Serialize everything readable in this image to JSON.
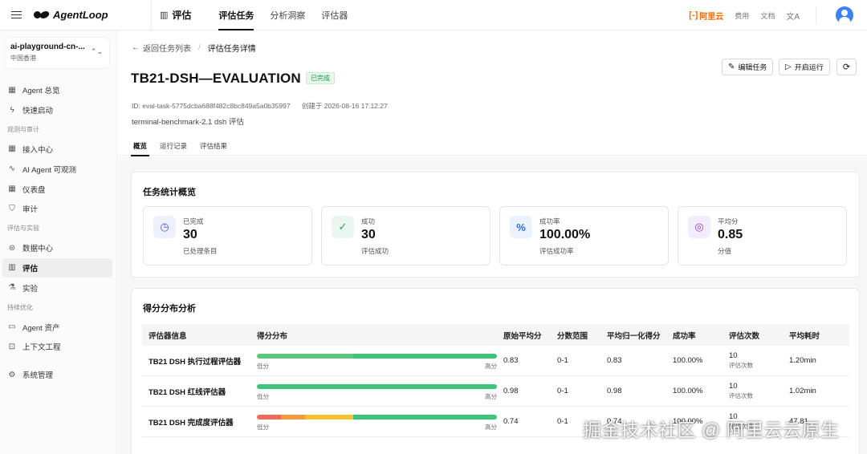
{
  "top": {
    "logo": "AgentLoop",
    "section": "评估",
    "nav": [
      "评估任务",
      "分析洞察",
      "评估器"
    ],
    "aliyun": "阿里云",
    "links": [
      "费用",
      "文档"
    ]
  },
  "sidebar": {
    "workspace_name": "ai-playground-cn-...",
    "workspace_region": "中国香港",
    "items": [
      {
        "type": "item",
        "label": "Agent 总览",
        "icon": "grid-icon"
      },
      {
        "type": "item",
        "label": "快速启动",
        "icon": "lightning-icon"
      },
      {
        "type": "group",
        "label": "观测与审计"
      },
      {
        "type": "item",
        "label": "接入中心",
        "icon": "grid-icon"
      },
      {
        "type": "item",
        "label": "AI Agent 可观测",
        "icon": "pulse-icon"
      },
      {
        "type": "item",
        "label": "仪表盘",
        "icon": "dashboard-icon"
      },
      {
        "type": "item",
        "label": "审计",
        "icon": "shield-icon"
      },
      {
        "type": "group",
        "label": "评估与实验"
      },
      {
        "type": "item",
        "label": "数据中心",
        "icon": "database-icon"
      },
      {
        "type": "item",
        "label": "评估",
        "icon": "chart-icon",
        "active": true
      },
      {
        "type": "item",
        "label": "实验",
        "icon": "flask-icon"
      },
      {
        "type": "group",
        "label": "持续优化"
      },
      {
        "type": "item",
        "label": "Agent 资产",
        "icon": "folder-icon"
      },
      {
        "type": "item",
        "label": "上下文工程",
        "icon": "book-icon"
      },
      {
        "type": "spacer"
      },
      {
        "type": "item",
        "label": "系统管理",
        "icon": "settings-icon"
      }
    ]
  },
  "breadcrumb": {
    "back": "返回任务列表",
    "current": "评估任务详情"
  },
  "header": {
    "title": "TB21-DSH—EVALUATION",
    "status": "已完成",
    "edit_label": "编辑任务",
    "run_label": "开启运行",
    "id_text": "ID: eval-task-5775dcba688f482c8bc849a5a0b35997",
    "created_text": "创建于 2026-08-16 17:12:27",
    "description": "terminal-benchmark-2.1 dsh 评估"
  },
  "tabs": [
    "概览",
    "运行记录",
    "评估结果"
  ],
  "stats": {
    "title": "任务统计概览",
    "items": [
      {
        "label": "已完成",
        "value": "30",
        "sub": "已处理条目",
        "icon": "clock-icon",
        "icon_glyph": "◷",
        "bg": "#eef0fb",
        "fg": "#4a5bd8"
      },
      {
        "label": "成功",
        "value": "30",
        "sub": "评估成功",
        "icon": "check-circle-icon",
        "icon_glyph": "✓",
        "bg": "#e9f7ee",
        "fg": "#23a455"
      },
      {
        "label": "成功率",
        "value": "100.00%",
        "sub": "评估成功率",
        "icon": "percent-icon",
        "icon_glyph": "%",
        "bg": "#eaf2fd",
        "fg": "#2f6fdb"
      },
      {
        "label": "平均分",
        "value": "0.85",
        "sub": "分值",
        "icon": "target-icon",
        "icon_glyph": "◎",
        "bg": "#f3ecfb",
        "fg": "#8d3fd6"
      }
    ]
  },
  "distribution": {
    "title": "得分分布分析",
    "headers": [
      "评估器信息",
      "得分分布",
      "原始平均分",
      "分数范围",
      "平均归一化得分",
      "成功率",
      "评估次数",
      "平均耗时"
    ],
    "low_label": "低分",
    "high_label": "高分",
    "count_label": "评估次数",
    "rows": [
      {
        "name": "TB21 DSH 执行过程评估器",
        "raw": "0.83",
        "range": "0-1",
        "norm": "0.83",
        "rate": "100.00%",
        "count": "10",
        "time": "1.20min",
        "segments": [
          {
            "fraction": 0.4,
            "color": "#5ac77d"
          },
          {
            "fraction": 0.6,
            "color": "#3cc47b"
          }
        ]
      },
      {
        "name": "TB21 DSH 红线评估器",
        "raw": "0.98",
        "range": "0-1",
        "norm": "0.98",
        "rate": "100.00%",
        "count": "10",
        "time": "1.02min",
        "segments": [
          {
            "fraction": 1.0,
            "color": "#3cc47b"
          }
        ]
      },
      {
        "name": "TB21 DSH 完成度评估器",
        "raw": "0.74",
        "range": "0-1",
        "norm": "0.74",
        "rate": "100.00%",
        "count": "10",
        "time": "47.81",
        "segments": [
          {
            "fraction": 0.1,
            "color": "#ef6b5b"
          },
          {
            "fraction": 0.1,
            "color": "#f39b3c"
          },
          {
            "fraction": 0.2,
            "color": "#f2c230"
          },
          {
            "fraction": 0.6,
            "color": "#3cc47b"
          }
        ]
      }
    ]
  },
  "watermark": "掘金技术社区 @ 阿里云云原生"
}
